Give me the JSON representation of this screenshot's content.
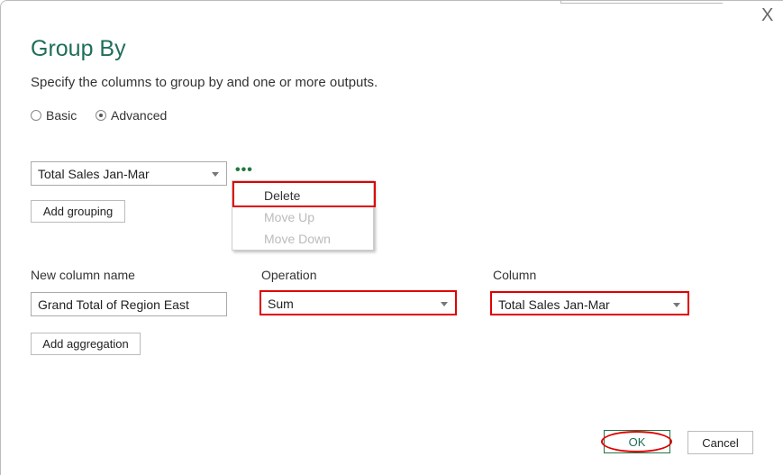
{
  "dialog": {
    "title": "Group By",
    "subtitle": "Specify the columns to group by and one or more outputs.",
    "close": "X"
  },
  "mode": {
    "basic": "Basic",
    "advanced": "Advanced",
    "selected": "Advanced"
  },
  "grouping": {
    "column": "Total Sales Jan-Mar",
    "more": "•••",
    "add_button": "Add grouping"
  },
  "context_menu": {
    "items": [
      {
        "label": "Delete",
        "enabled": true
      },
      {
        "label": "Move Up",
        "enabled": false
      },
      {
        "label": "Move Down",
        "enabled": false
      }
    ]
  },
  "aggregation": {
    "new_column_label": "New column name",
    "operation_label": "Operation",
    "column_label": "Column",
    "new_column_value": "Grand Total of Region East",
    "operation_value": "Sum",
    "column_value": "Total Sales Jan-Mar",
    "add_button": "Add aggregation"
  },
  "footer": {
    "ok": "OK",
    "cancel": "Cancel"
  },
  "colors": {
    "highlight": "#e00000",
    "accent": "#217346"
  }
}
